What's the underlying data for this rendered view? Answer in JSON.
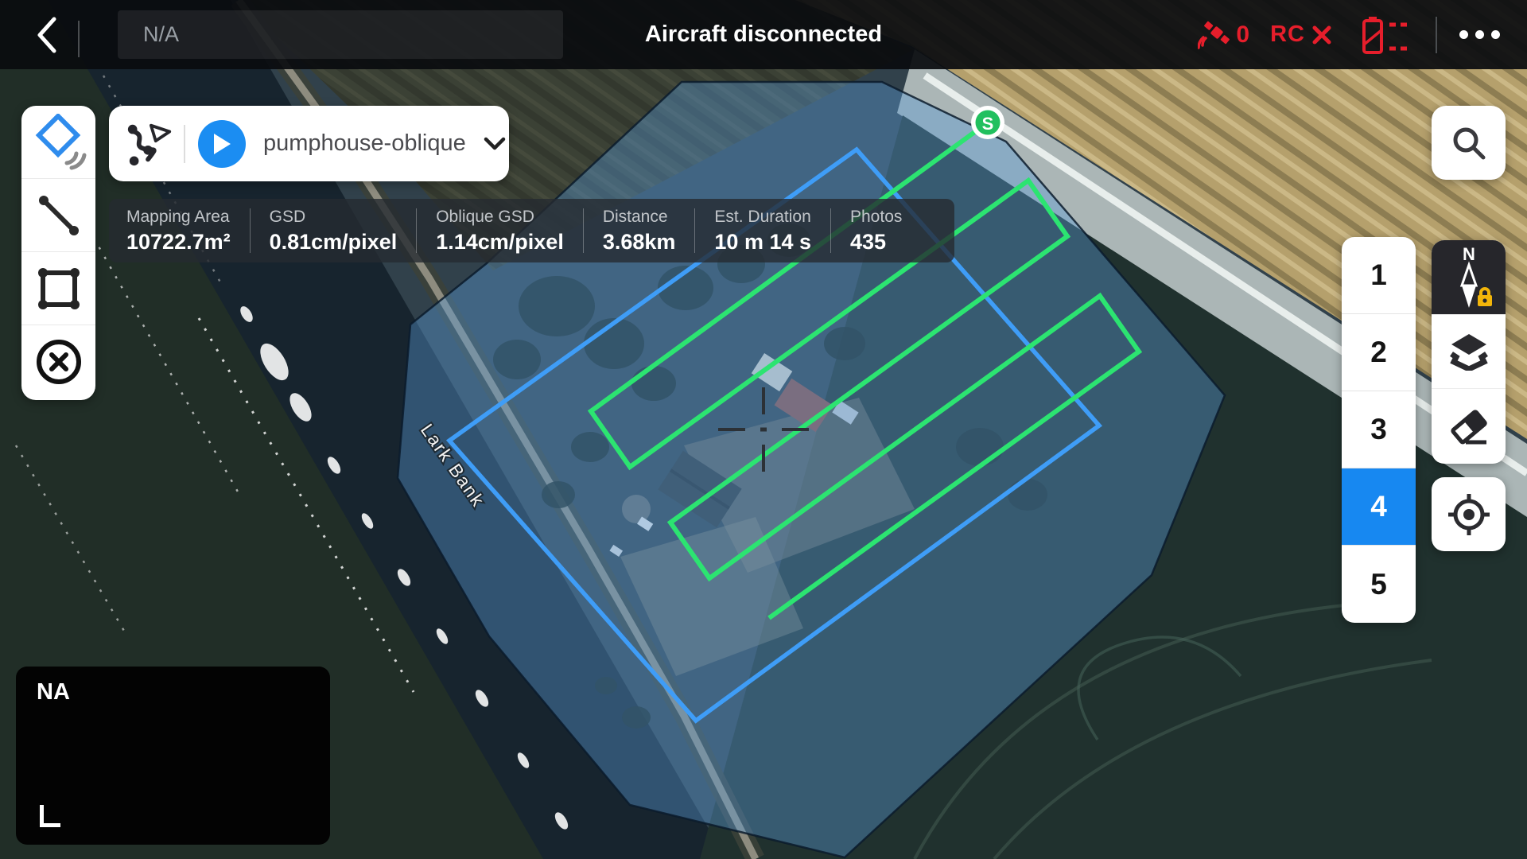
{
  "top_bar": {
    "mission_name": "N/A",
    "title": "Aircraft disconnected",
    "satellite_count": "0",
    "rc_status_label": "RC"
  },
  "mission_panel": {
    "mission_name": "pumphouse-oblique"
  },
  "stats": {
    "items": [
      {
        "label": "Mapping Area",
        "value": "10722.7m²"
      },
      {
        "label": "GSD",
        "value": "0.81cm/pixel"
      },
      {
        "label": "Oblique GSD",
        "value": "1.14cm/pixel"
      },
      {
        "label": "Distance",
        "value": "3.68km"
      },
      {
        "label": "Est. Duration",
        "value": "10 m 14 s"
      },
      {
        "label": "Photos",
        "value": "435"
      }
    ]
  },
  "waypoint_list": {
    "items": [
      "1",
      "2",
      "3",
      "4",
      "5"
    ],
    "selected": "4"
  },
  "compass": {
    "north_label": "N"
  },
  "map": {
    "road_label": "Lark Bank",
    "start_marker_label": "S",
    "camera_feed_status": "NA"
  },
  "colors": {
    "accent_blue": "#1b8df2",
    "selected_blue": "#1788f1",
    "flight_green": "#2ce471",
    "boundary_blue": "#3f9df7",
    "survey_fill_blue": "#5b9bd8",
    "alert_red": "#e61e2b"
  }
}
